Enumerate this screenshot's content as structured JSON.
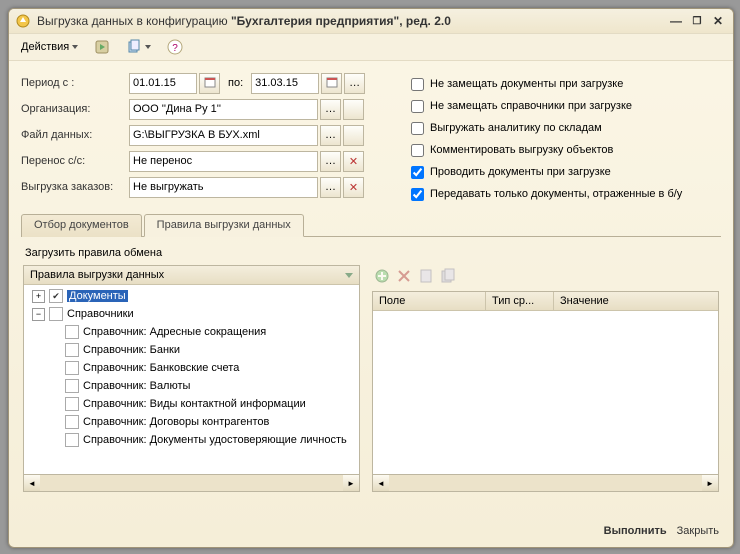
{
  "titlebar": {
    "title_prefix": "Выгрузка данных в конфигурацию ",
    "title_bold": "\"Бухгалтерия предприятия\", ред.  2.0"
  },
  "toolbar": {
    "actions_label": "Действия"
  },
  "form": {
    "period_label": "Период с :",
    "period_from": "01.01.15",
    "period_to_label": "по:",
    "period_to": "31.03.15",
    "org_label": "Организация:",
    "org_value": "ООО ''Дина Ру 1''",
    "file_label": "Файл данных:",
    "file_value": "G:\\ВЫГРУЗКА В БУХ.xml",
    "transfer_label": "Перенос с/с:",
    "transfer_value": "Не перенос",
    "orders_label": "Выгрузка заказов:",
    "orders_value": "Не выгружать"
  },
  "options": {
    "o1": "Не замещать документы при загрузке",
    "o2": "Не замещать справочники при загрузке",
    "o3": "Выгружать аналитику по складам",
    "o4": "Комментировать выгрузку объектов",
    "o5": "Проводить документы при загрузке",
    "o6": "Передавать только документы, отраженные в б/у"
  },
  "tabs": {
    "t1": "Отбор документов",
    "t2": "Правила выгрузки данных"
  },
  "sublabel": "Загрузить правила обмена",
  "tree": {
    "header": "Правила выгрузки данных",
    "n_docs": "Документы",
    "n_refs": "Справочники",
    "items": [
      "Справочник: Адресные сокращения",
      "Справочник: Банки",
      "Справочник: Банковские счета",
      "Справочник: Валюты",
      "Справочник: Виды контактной информации",
      "Справочник: Договоры контрагентов",
      "Справочник: Документы удостоверяющие личность"
    ]
  },
  "grid": {
    "c1": "Поле",
    "c2": "Тип ср...",
    "c3": "Значение"
  },
  "footer": {
    "execute": "Выполнить",
    "close": "Закрыть"
  }
}
